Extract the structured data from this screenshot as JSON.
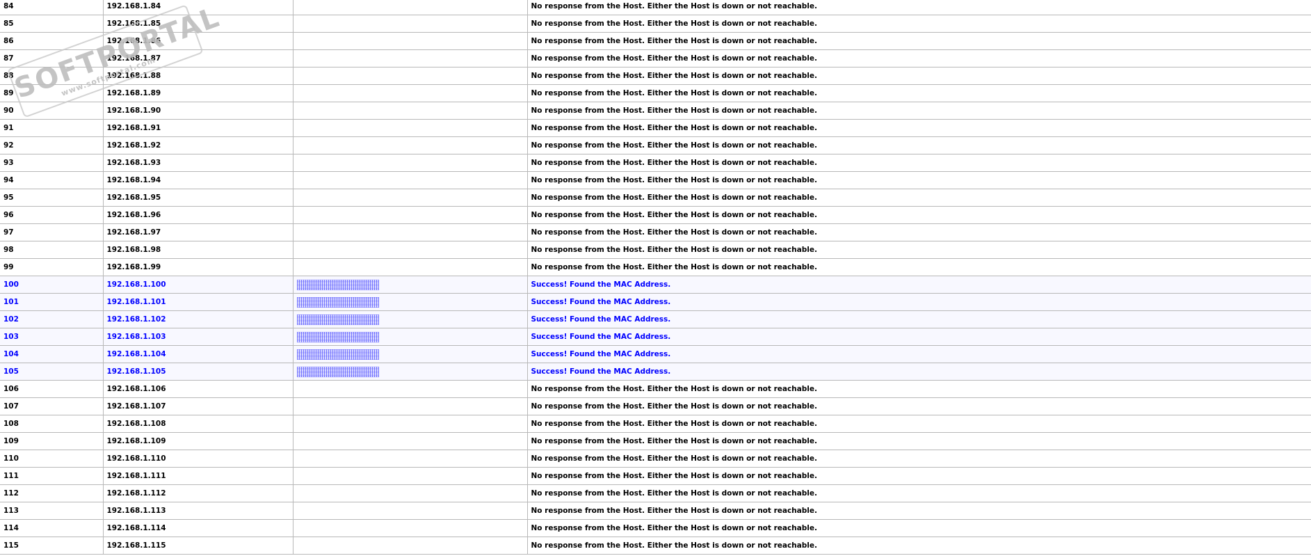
{
  "watermark": {
    "logo": "SOFTPORTAL",
    "url": "www.softportal.com"
  },
  "colors": {
    "success_text": "#0000ff",
    "success_bg": "#f8f8ff",
    "border": "#b8b8b8"
  },
  "messages": {
    "fail": "No response from the Host. Either the Host is down or not reachable.",
    "success": "Success! Found the MAC Address."
  },
  "rows": [
    {
      "no": "84",
      "ip": "192.168.1.84",
      "ok": false
    },
    {
      "no": "85",
      "ip": "192.168.1.85",
      "ok": false
    },
    {
      "no": "86",
      "ip": "192.168.1.86",
      "ok": false
    },
    {
      "no": "87",
      "ip": "192.168.1.87",
      "ok": false
    },
    {
      "no": "88",
      "ip": "192.168.1.88",
      "ok": false
    },
    {
      "no": "89",
      "ip": "192.168.1.89",
      "ok": false
    },
    {
      "no": "90",
      "ip": "192.168.1.90",
      "ok": false
    },
    {
      "no": "91",
      "ip": "192.168.1.91",
      "ok": false
    },
    {
      "no": "92",
      "ip": "192.168.1.92",
      "ok": false
    },
    {
      "no": "93",
      "ip": "192.168.1.93",
      "ok": false
    },
    {
      "no": "94",
      "ip": "192.168.1.94",
      "ok": false
    },
    {
      "no": "95",
      "ip": "192.168.1.95",
      "ok": false
    },
    {
      "no": "96",
      "ip": "192.168.1.96",
      "ok": false
    },
    {
      "no": "97",
      "ip": "192.168.1.97",
      "ok": false
    },
    {
      "no": "98",
      "ip": "192.168.1.98",
      "ok": false
    },
    {
      "no": "99",
      "ip": "192.168.1.99",
      "ok": false
    },
    {
      "no": "100",
      "ip": "192.168.1.100",
      "ok": true
    },
    {
      "no": "101",
      "ip": "192.168.1.101",
      "ok": true
    },
    {
      "no": "102",
      "ip": "192.168.1.102",
      "ok": true
    },
    {
      "no": "103",
      "ip": "192.168.1.103",
      "ok": true
    },
    {
      "no": "104",
      "ip": "192.168.1.104",
      "ok": true
    },
    {
      "no": "105",
      "ip": "192.168.1.105",
      "ok": true
    },
    {
      "no": "106",
      "ip": "192.168.1.106",
      "ok": false
    },
    {
      "no": "107",
      "ip": "192.168.1.107",
      "ok": false
    },
    {
      "no": "108",
      "ip": "192.168.1.108",
      "ok": false
    },
    {
      "no": "109",
      "ip": "192.168.1.109",
      "ok": false
    },
    {
      "no": "110",
      "ip": "192.168.1.110",
      "ok": false
    },
    {
      "no": "111",
      "ip": "192.168.1.111",
      "ok": false
    },
    {
      "no": "112",
      "ip": "192.168.1.112",
      "ok": false
    },
    {
      "no": "113",
      "ip": "192.168.1.113",
      "ok": false
    },
    {
      "no": "114",
      "ip": "192.168.1.114",
      "ok": false
    },
    {
      "no": "115",
      "ip": "192.168.1.115",
      "ok": false
    }
  ]
}
